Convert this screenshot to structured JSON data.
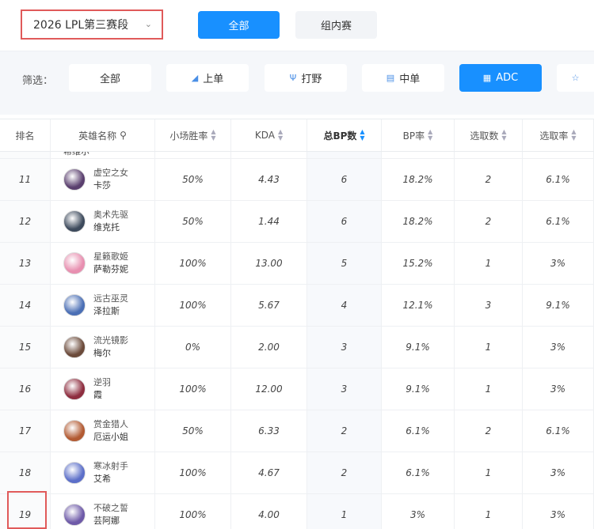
{
  "season_select": {
    "value": "2026 LPL第三赛段"
  },
  "scope_tabs": [
    {
      "label": "全部",
      "active": true
    },
    {
      "label": "组内赛",
      "active": false
    }
  ],
  "filter": {
    "label": "筛选：",
    "options": [
      {
        "label": "全部",
        "icon": "",
        "active": false
      },
      {
        "label": "上单",
        "icon": "top-lane-icon",
        "active": false
      },
      {
        "label": "打野",
        "icon": "jungle-icon",
        "active": false
      },
      {
        "label": "中单",
        "icon": "mid-lane-icon",
        "active": false
      },
      {
        "label": "ADC",
        "icon": "adc-icon",
        "active": true
      }
    ]
  },
  "table": {
    "headers": [
      "排名",
      "英雄名称",
      "小场胜率",
      "KDA",
      "总BP数",
      "BP率",
      "选取数",
      "选取率"
    ],
    "partial_top_name": "希维尔",
    "rows": [
      {
        "rank": "11",
        "title": "虚空之女",
        "name": "卡莎",
        "win_rate": "50%",
        "kda": "4.43",
        "bp": "6",
        "bp_rate": "18.2%",
        "picks": "2",
        "pick_rate": "6.1%",
        "avatar_color": "#5a3f6e"
      },
      {
        "rank": "12",
        "title": "奥术先驱",
        "name": "维克托",
        "win_rate": "50%",
        "kda": "1.44",
        "bp": "6",
        "bp_rate": "18.2%",
        "picks": "2",
        "pick_rate": "6.1%",
        "avatar_color": "#3d4a5c"
      },
      {
        "rank": "13",
        "title": "星籁歌姬",
        "name": "萨勒芬妮",
        "win_rate": "100%",
        "kda": "13.00",
        "bp": "5",
        "bp_rate": "15.2%",
        "picks": "1",
        "pick_rate": "3%",
        "avatar_color": "#e88fb0"
      },
      {
        "rank": "14",
        "title": "远古巫灵",
        "name": "泽拉斯",
        "win_rate": "100%",
        "kda": "5.67",
        "bp": "4",
        "bp_rate": "12.1%",
        "picks": "3",
        "pick_rate": "9.1%",
        "avatar_color": "#4b6fb5"
      },
      {
        "rank": "15",
        "title": "流光镜影",
        "name": "梅尔",
        "win_rate": "0%",
        "kda": "2.00",
        "bp": "3",
        "bp_rate": "9.1%",
        "picks": "1",
        "pick_rate": "3%",
        "avatar_color": "#6b4a3a"
      },
      {
        "rank": "16",
        "title": "逆羽",
        "name": "霞",
        "win_rate": "100%",
        "kda": "12.00",
        "bp": "3",
        "bp_rate": "9.1%",
        "picks": "1",
        "pick_rate": "3%",
        "avatar_color": "#8e2d3f"
      },
      {
        "rank": "17",
        "title": "赏金猎人",
        "name": "厄运小姐",
        "win_rate": "50%",
        "kda": "6.33",
        "bp": "2",
        "bp_rate": "6.1%",
        "picks": "2",
        "pick_rate": "6.1%",
        "avatar_color": "#b25a32"
      },
      {
        "rank": "18",
        "title": "寒冰射手",
        "name": "艾希",
        "win_rate": "100%",
        "kda": "4.67",
        "bp": "2",
        "bp_rate": "6.1%",
        "picks": "1",
        "pick_rate": "3%",
        "avatar_color": "#5c6fc9"
      },
      {
        "rank": "19",
        "title": "不破之誓",
        "name": "芸阿娜",
        "win_rate": "100%",
        "kda": "4.00",
        "bp": "1",
        "bp_rate": "3%",
        "picks": "1",
        "pick_rate": "3%",
        "avatar_color": "#6e5aa8"
      }
    ]
  },
  "colors": {
    "accent": "#1890ff",
    "highlight_border": "#e05a5a"
  }
}
